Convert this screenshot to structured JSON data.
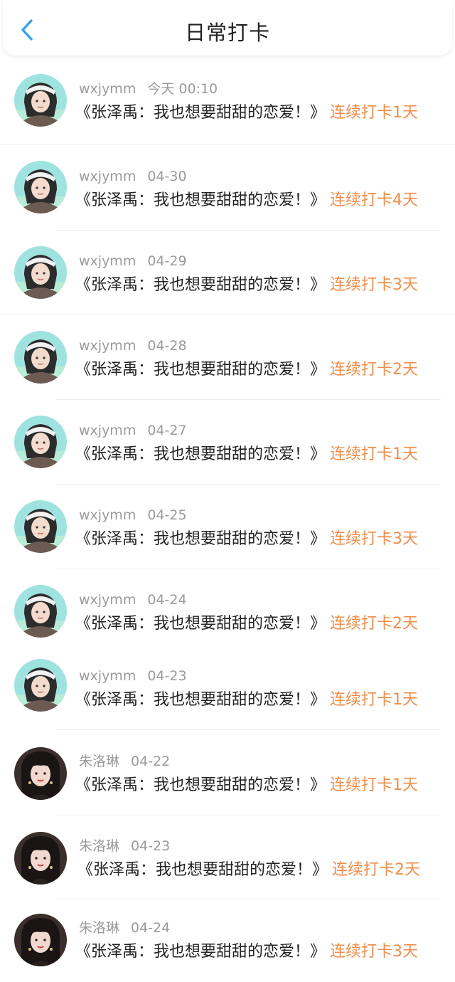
{
  "header": {
    "title": "日常打卡",
    "back_icon": "chevron-left-icon"
  },
  "colors": {
    "accent_blue": "#3a9ef2",
    "streak_orange": "#ee8d4a",
    "meta_gray": "#9a9a9a",
    "text_dark": "#222222"
  },
  "items": [
    {
      "user": "wxjymm",
      "time": "今天 00:10",
      "title": "《张泽禹：我也想要甜甜的恋爱！》",
      "streak": "连续打卡1天",
      "avatar": "teal-avatar-icon"
    },
    {
      "user": "wxjymm",
      "time": "04-30",
      "title": "《张泽禹：我也想要甜甜的恋爱！》",
      "streak": "连续打卡4天",
      "avatar": "teal-avatar-icon"
    },
    {
      "user": "wxjymm",
      "time": "04-29",
      "title": "《张泽禹：我也想要甜甜的恋爱！》",
      "streak": "连续打卡3天",
      "avatar": "teal-avatar-icon"
    },
    {
      "user": "wxjymm",
      "time": "04-28",
      "title": "《张泽禹：我也想要甜甜的恋爱！》",
      "streak": "连续打卡2天",
      "avatar": "teal-avatar-icon"
    },
    {
      "user": "wxjymm",
      "time": "04-27",
      "title": "《张泽禹：我也想要甜甜的恋爱！》",
      "streak": "连续打卡1天",
      "avatar": "teal-avatar-icon"
    },
    {
      "user": "wxjymm",
      "time": "04-25",
      "title": "《张泽禹：我也想要甜甜的恋爱！》",
      "streak": "连续打卡3天",
      "avatar": "teal-avatar-icon"
    },
    {
      "user": "wxjymm",
      "time": "04-24",
      "title": "《张泽禹：我也想要甜甜的恋爱！》",
      "streak": "连续打卡2天",
      "avatar": "teal-avatar-icon"
    },
    {
      "user": "wxjymm",
      "time": "04-23",
      "title": "《张泽禹：我也想要甜甜的恋爱！》",
      "streak": "连续打卡1天",
      "avatar": "teal-avatar-icon"
    },
    {
      "user": "朱洛琳",
      "time": "04-22",
      "title": "《张泽禹：我也想要甜甜的恋爱！》",
      "streak": "连续打卡1天",
      "avatar": "dark-avatar-icon"
    },
    {
      "user": "朱洛琳",
      "time": "04-23",
      "title": "《张泽禹：我也想要甜甜的恋爱！》",
      "streak": "连续打卡2天",
      "avatar": "dark-avatar-icon"
    },
    {
      "user": "朱洛琳",
      "time": "04-24",
      "title": "《张泽禹：我也想要甜甜的恋爱！》",
      "streak": "连续打卡3天",
      "avatar": "dark-avatar-icon"
    }
  ]
}
